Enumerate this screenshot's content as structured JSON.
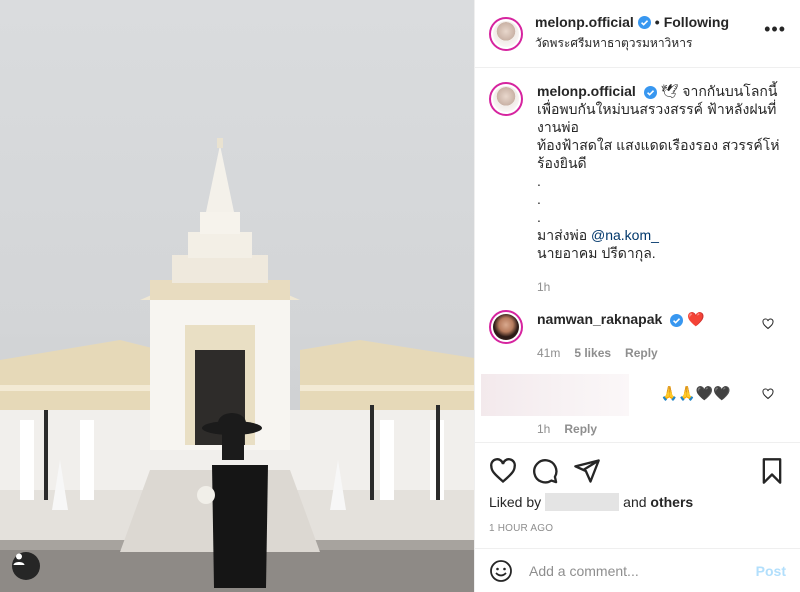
{
  "post": {
    "author": {
      "username": "melonp.official",
      "follow_status": "Following",
      "location": "วัดพระศรีมหาธาตุวรมหาวิหาร"
    },
    "caption": {
      "username": "melonp.official",
      "emoji": "🕊",
      "lines": [
        "จากกันบนโลกนี้",
        "เพื่อพบกันใหม่บนสรวงสรรค์ ฟ้าหลังฝนที่",
        "งานพ่อ",
        "ท้องฟ้าสดใส แสงแดดเรืองรอง สวรรค์โห่",
        "ร้องยินดี",
        ".",
        ".",
        ".",
        "มาส่งพ่อ"
      ],
      "mention": "@na.kom_",
      "last_line": "นายอาคม ปรีดากุล.",
      "time": "1h"
    },
    "comments": [
      {
        "username": "namwan_raknapak",
        "text": "❤️",
        "time": "41m",
        "likes": "5 likes",
        "reply_label": "Reply"
      },
      {
        "username": "",
        "text": "🙏🙏🖤🖤",
        "time": "1h",
        "reply_label": "Reply"
      }
    ],
    "liked_by": {
      "prefix": "Liked by",
      "connector": "and",
      "others": "others"
    },
    "time_ago": "1 HOUR AGO",
    "add_comment": {
      "placeholder": "Add a comment...",
      "post_label": "Post"
    },
    "more_label": "•••"
  },
  "colors": {
    "verified": "#3897f0",
    "heart_red": "#ed4956",
    "link": "#00376b",
    "post_disabled": "#b2dffc",
    "story_ring": "#d6249f"
  },
  "icons": [
    "user-tag-icon",
    "verified-icon",
    "more-icon",
    "heart-icon",
    "comment-icon",
    "share-icon",
    "bookmark-icon",
    "emoji-icon"
  ]
}
